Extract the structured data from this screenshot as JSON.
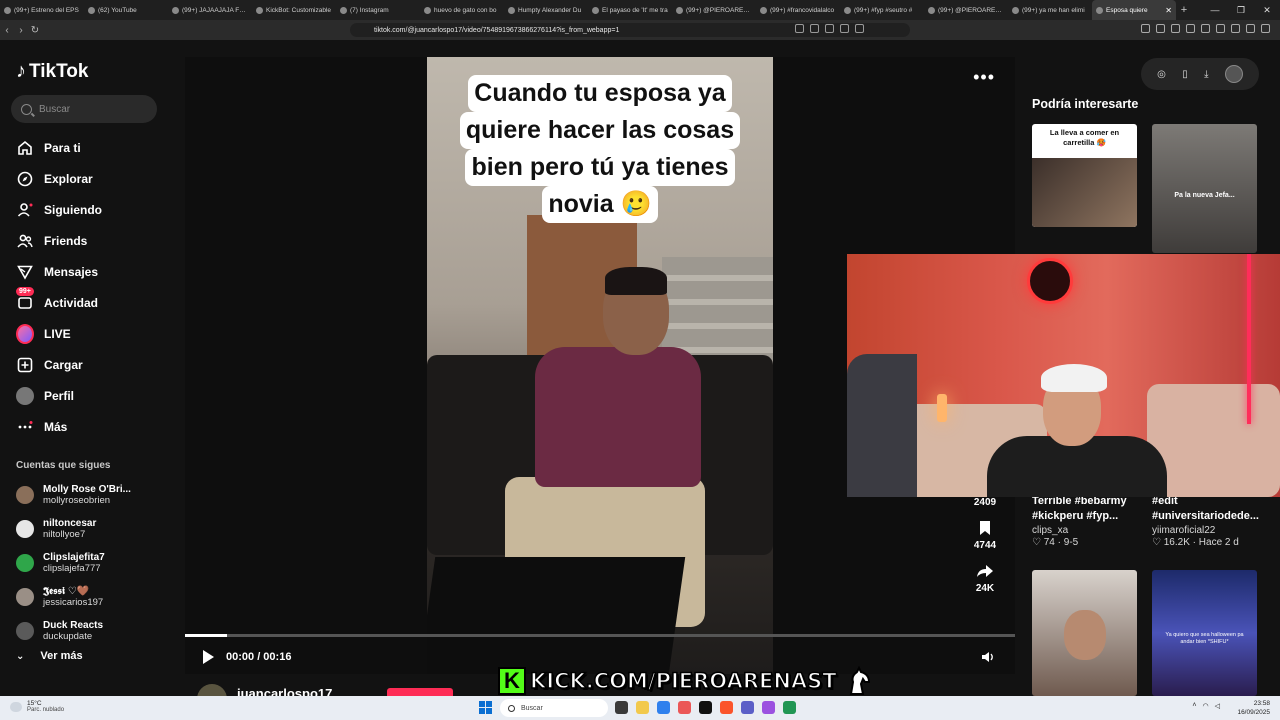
{
  "browser": {
    "tabs": [
      {
        "label": "(99+) Estreno del EPS"
      },
      {
        "label": "(62) YouTube"
      },
      {
        "label": "(99+) JAJAAJAJA FRIA"
      },
      {
        "label": "KickBot: Customizable"
      },
      {
        "label": "(7) Instagram"
      },
      {
        "label": "huevo de gato con bo"
      },
      {
        "label": "Humpty Alexander Du"
      },
      {
        "label": "El payaso de 'It' me tra"
      },
      {
        "label": "(99+) @PIEROARENA"
      },
      {
        "label": "(99+) #francovidalalco"
      },
      {
        "label": "(99+) #fyp #seutro #"
      },
      {
        "label": "(99+) @PIEROARENA"
      },
      {
        "label": "(99+) ya me han elimi"
      },
      {
        "label": "Esposa quiere"
      }
    ],
    "new_tab": "+",
    "close_tab": "✕",
    "window_controls": [
      "—",
      "❐",
      "✕"
    ],
    "url": "tiktok.com/@juancarlospo17/video/7548919673866276114?is_from_webapp=1"
  },
  "sidebar": {
    "logo": "TikTok",
    "search_placeholder": "Buscar",
    "nav": [
      {
        "label": "Para ti",
        "icon": "home-icon"
      },
      {
        "label": "Explorar",
        "icon": "compass-icon"
      },
      {
        "label": "Siguiendo",
        "icon": "following-icon"
      },
      {
        "label": "Friends",
        "icon": "friends-icon"
      },
      {
        "label": "Mensajes",
        "icon": "messages-icon"
      },
      {
        "label": "Actividad",
        "icon": "activity-icon",
        "badge": "99+"
      },
      {
        "label": "LIVE",
        "icon": "live-icon"
      },
      {
        "label": "Cargar",
        "icon": "upload-icon"
      },
      {
        "label": "Perfil",
        "icon": "profile-icon"
      },
      {
        "label": "Más",
        "icon": "more-icon"
      }
    ],
    "following_title": "Cuentas que sigues",
    "following": [
      {
        "name": "Molly Rose O'Bri...",
        "user": "mollyroseobrien"
      },
      {
        "name": "niltoncesar",
        "user": "niltollyoe7"
      },
      {
        "name": "Clipslajefita7",
        "user": "clipslajefa777"
      },
      {
        "name": "𝕵𝖊𝖘𝖘𝖎 ♡🤎",
        "user": "jessicarios197"
      },
      {
        "name": "Duck Reacts",
        "user": "duckupdate"
      }
    ],
    "ver_mas": "Ver más"
  },
  "video": {
    "caption_lines": [
      "Cuando tu esposa ya",
      "quiere hacer las cosas",
      "bien pero tú ya tienes",
      "novia 🥲"
    ],
    "time": "00:00 / 00:16",
    "progress": 0.05,
    "actions": [
      {
        "icon": "share-icon",
        "count": "2409"
      },
      {
        "icon": "bookmark-icon",
        "count": "4744"
      },
      {
        "icon": "forward-icon",
        "count": "24K"
      }
    ],
    "author": "juancarlospo17"
  },
  "recommend": {
    "title": "Podría interesarte",
    "items": [
      {
        "thumb_caption": "La lleva a comer en carretilla 🥵"
      },
      {
        "thumb_caption": "Pa la nueva Jefa..."
      },
      {
        "title": "Terrible #bebarmy #kickperu #fyp...",
        "user": "clips_xa",
        "likes": "♡ 74",
        "date": "9-5"
      },
      {
        "title": "#edit #universitariodede...",
        "user": "yiimaroficial22",
        "likes": "♡ 16.2K",
        "date": "Hace 2 d"
      },
      {
        "thumb_caption": ""
      },
      {
        "thumb_caption": "Ya quiero que sea halloween pa andar bien *SHIFU*"
      }
    ]
  },
  "stream": {
    "kick_url": "KICK.COM/PIEROARENAST",
    "kick_letter": "K"
  },
  "taskbar": {
    "temp": "15°C",
    "condition": "Parc. nublado",
    "search": "Buscar",
    "time": "23:58",
    "date": "16/09/2025"
  }
}
